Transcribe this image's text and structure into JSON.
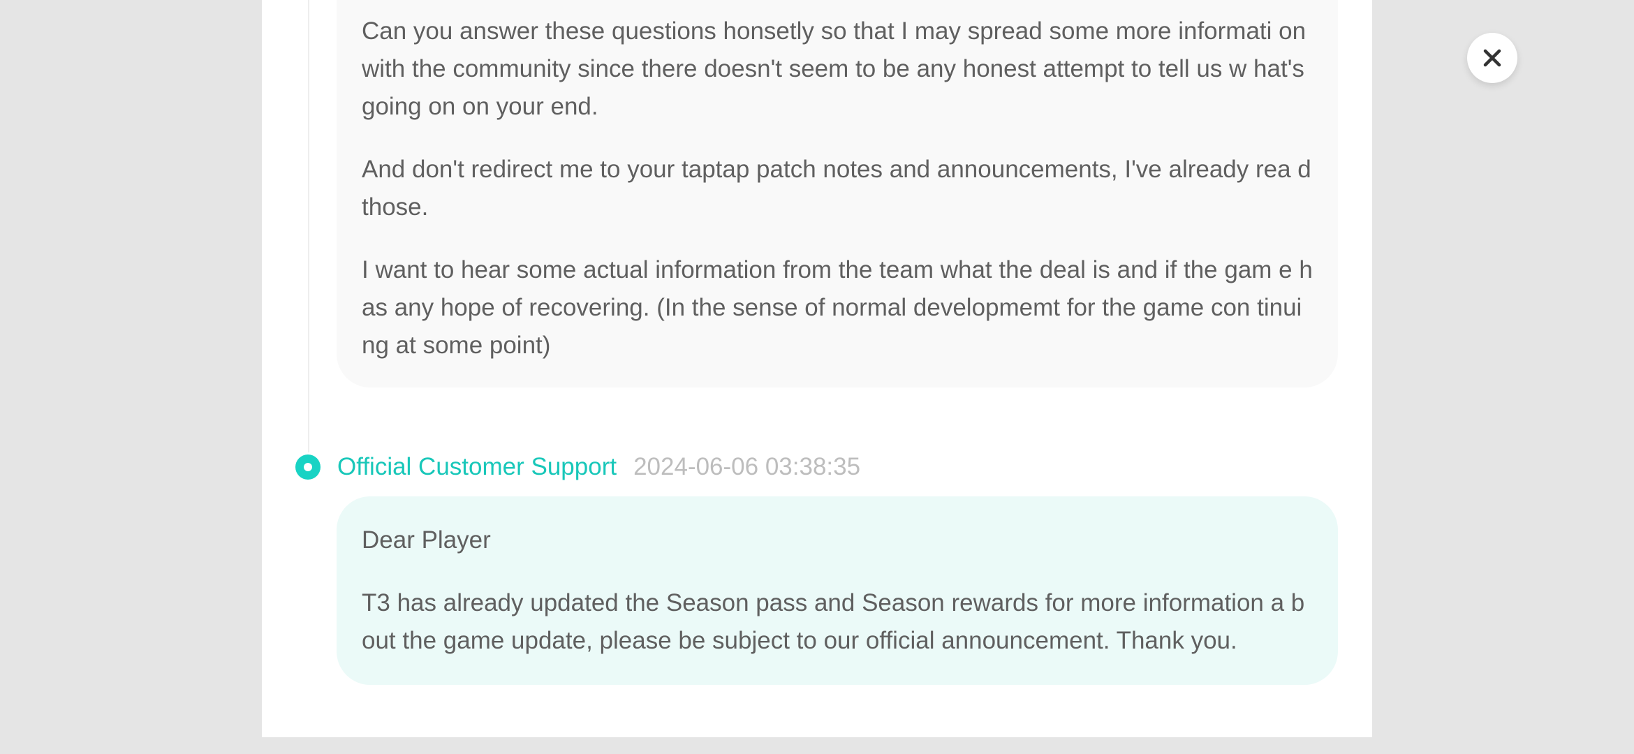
{
  "thread": {
    "user_message": {
      "paragraphs": [
        "Can you answer these questions honsetly so that I may spread some more informati on with the community since there doesn't seem to be any honest attempt to tell us w hat's going on on your end.",
        "And don't redirect me to your taptap patch notes and announcements, I've already rea d those.",
        "I want to hear some actual information from the team what the deal is and if the gam e has any hope of recovering. (In the sense of normal developmemt for the game con tinuing at some point)"
      ]
    },
    "reply": {
      "author": "Official Customer Support",
      "timestamp": "2024-06-06 03:38:35",
      "paragraphs": [
        "Dear Player",
        "T3 has already updated the Season pass and Season rewards for more information a bout the game update, please be subject to our official announcement. Thank you."
      ]
    }
  },
  "close_button": {
    "icon": "close-icon"
  },
  "colors": {
    "accent": "#18d3c4",
    "user_bubble": "#f9f9f9",
    "support_bubble": "#ebfaf8",
    "background": "#e5e5e5"
  }
}
